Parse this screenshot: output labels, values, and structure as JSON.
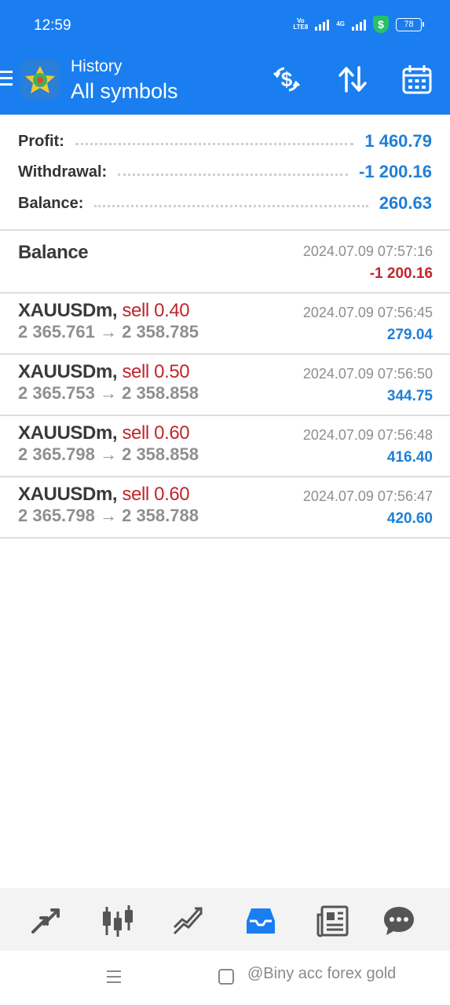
{
  "status_bar": {
    "time": "12:59",
    "network_label_1": "Vo",
    "network_label_2": "LTE8",
    "network_label_3": "4G",
    "shield_symbol": "$",
    "battery": "78"
  },
  "header": {
    "subtitle": "History",
    "title": "All symbols",
    "bg_color": "#1a7ef0"
  },
  "summary": [
    {
      "label": "Profit:",
      "value": "1 460.79"
    },
    {
      "label": "Withdrawal:",
      "value": "-1 200.16"
    },
    {
      "label": "Balance:",
      "value": "260.63"
    }
  ],
  "balance_entry": {
    "label": "Balance",
    "time": "2024.07.09 07:57:16",
    "amount": "-1 200.16"
  },
  "deals": [
    {
      "symbol": "XAUUSDm,",
      "type": "sell 0.40",
      "prices": "2 365.761 → 2 358.785",
      "time": "2024.07.09 07:56:45",
      "profit": "279.04"
    },
    {
      "symbol": "XAUUSDm,",
      "type": "sell 0.50",
      "prices": "2 365.753 → 2 358.858",
      "time": "2024.07.09 07:56:50",
      "profit": "344.75"
    },
    {
      "symbol": "XAUUSDm,",
      "type": "sell 0.60",
      "prices": "2 365.798 → 2 358.858",
      "time": "2024.07.09 07:56:48",
      "profit": "416.40"
    },
    {
      "symbol": "XAUUSDm,",
      "type": "sell 0.60",
      "prices": "2 365.798 → 2 358.788",
      "time": "2024.07.09 07:56:47",
      "profit": "420.60"
    }
  ],
  "bottom_nav": {
    "items": [
      "quotes-icon",
      "chart-icon",
      "trade-icon",
      "history-icon",
      "news-icon",
      "chat-icon"
    ],
    "active": "history-icon",
    "active_color": "#1a7ef0"
  },
  "watermark": "@Biny acc forex gold",
  "colors": {
    "profit_blue": "#1f7fd6",
    "loss_red": "#c0262c",
    "sell_red": "#c0262c"
  }
}
